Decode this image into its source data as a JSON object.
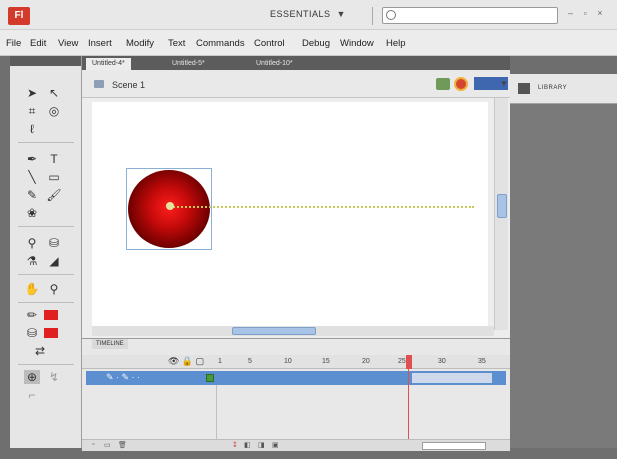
{
  "app": {
    "logo": "Fl",
    "workspace_label": "ESSENTIALS",
    "window_controls": "– ▫ ×"
  },
  "menu": [
    "File",
    "Edit",
    "View",
    "Insert",
    "Modify",
    "Text",
    "Commands",
    "Control",
    "Debug",
    "Window",
    "Help"
  ],
  "document": {
    "tabs": [
      "Untitled-4*",
      "Untitled-5*",
      "Untitled-10*"
    ],
    "active_tab": 0
  },
  "edit_bar": {
    "scene_label": "Scene 1"
  },
  "stage": {
    "ball_color": "#d10f0f",
    "path_color": "#c8c858"
  },
  "timeline": {
    "tab_label": "TIMELINE",
    "frame_numbers": [
      "1",
      "5",
      "10",
      "15",
      "20",
      "25",
      "30",
      "35"
    ],
    "playhead_frame": 25
  },
  "panels": {
    "library_label": "LIBRARY"
  },
  "colors": {
    "layer_row": "#5c8fcf",
    "playhead": "#e05050",
    "accent_blue": "#3e67b0"
  }
}
